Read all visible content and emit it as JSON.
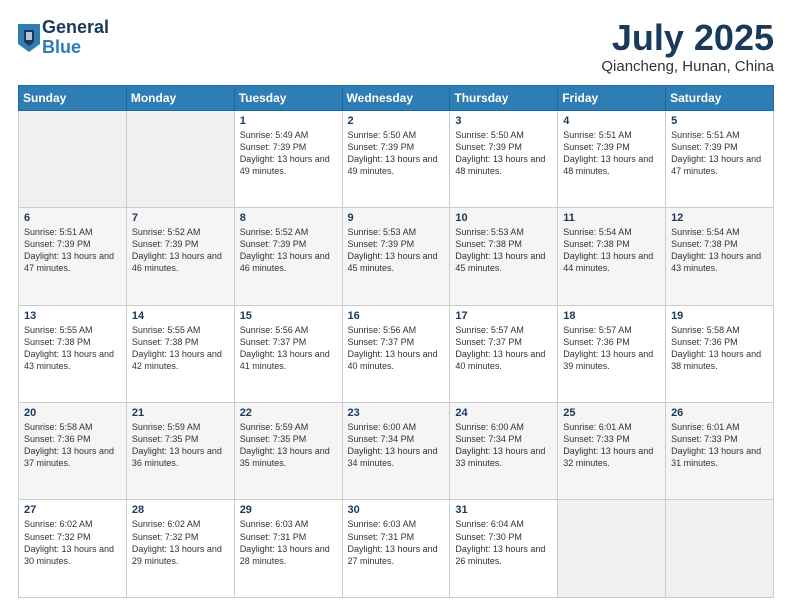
{
  "header": {
    "logo_general": "General",
    "logo_blue": "Blue",
    "month_title": "July 2025",
    "location": "Qiancheng, Hunan, China"
  },
  "weekdays": [
    "Sunday",
    "Monday",
    "Tuesday",
    "Wednesday",
    "Thursday",
    "Friday",
    "Saturday"
  ],
  "weeks": [
    [
      {
        "day": "",
        "info": ""
      },
      {
        "day": "",
        "info": ""
      },
      {
        "day": "1",
        "info": "Sunrise: 5:49 AM\nSunset: 7:39 PM\nDaylight: 13 hours and 49 minutes."
      },
      {
        "day": "2",
        "info": "Sunrise: 5:50 AM\nSunset: 7:39 PM\nDaylight: 13 hours and 49 minutes."
      },
      {
        "day": "3",
        "info": "Sunrise: 5:50 AM\nSunset: 7:39 PM\nDaylight: 13 hours and 48 minutes."
      },
      {
        "day": "4",
        "info": "Sunrise: 5:51 AM\nSunset: 7:39 PM\nDaylight: 13 hours and 48 minutes."
      },
      {
        "day": "5",
        "info": "Sunrise: 5:51 AM\nSunset: 7:39 PM\nDaylight: 13 hours and 47 minutes."
      }
    ],
    [
      {
        "day": "6",
        "info": "Sunrise: 5:51 AM\nSunset: 7:39 PM\nDaylight: 13 hours and 47 minutes."
      },
      {
        "day": "7",
        "info": "Sunrise: 5:52 AM\nSunset: 7:39 PM\nDaylight: 13 hours and 46 minutes."
      },
      {
        "day": "8",
        "info": "Sunrise: 5:52 AM\nSunset: 7:39 PM\nDaylight: 13 hours and 46 minutes."
      },
      {
        "day": "9",
        "info": "Sunrise: 5:53 AM\nSunset: 7:39 PM\nDaylight: 13 hours and 45 minutes."
      },
      {
        "day": "10",
        "info": "Sunrise: 5:53 AM\nSunset: 7:38 PM\nDaylight: 13 hours and 45 minutes."
      },
      {
        "day": "11",
        "info": "Sunrise: 5:54 AM\nSunset: 7:38 PM\nDaylight: 13 hours and 44 minutes."
      },
      {
        "day": "12",
        "info": "Sunrise: 5:54 AM\nSunset: 7:38 PM\nDaylight: 13 hours and 43 minutes."
      }
    ],
    [
      {
        "day": "13",
        "info": "Sunrise: 5:55 AM\nSunset: 7:38 PM\nDaylight: 13 hours and 43 minutes."
      },
      {
        "day": "14",
        "info": "Sunrise: 5:55 AM\nSunset: 7:38 PM\nDaylight: 13 hours and 42 minutes."
      },
      {
        "day": "15",
        "info": "Sunrise: 5:56 AM\nSunset: 7:37 PM\nDaylight: 13 hours and 41 minutes."
      },
      {
        "day": "16",
        "info": "Sunrise: 5:56 AM\nSunset: 7:37 PM\nDaylight: 13 hours and 40 minutes."
      },
      {
        "day": "17",
        "info": "Sunrise: 5:57 AM\nSunset: 7:37 PM\nDaylight: 13 hours and 40 minutes."
      },
      {
        "day": "18",
        "info": "Sunrise: 5:57 AM\nSunset: 7:36 PM\nDaylight: 13 hours and 39 minutes."
      },
      {
        "day": "19",
        "info": "Sunrise: 5:58 AM\nSunset: 7:36 PM\nDaylight: 13 hours and 38 minutes."
      }
    ],
    [
      {
        "day": "20",
        "info": "Sunrise: 5:58 AM\nSunset: 7:36 PM\nDaylight: 13 hours and 37 minutes."
      },
      {
        "day": "21",
        "info": "Sunrise: 5:59 AM\nSunset: 7:35 PM\nDaylight: 13 hours and 36 minutes."
      },
      {
        "day": "22",
        "info": "Sunrise: 5:59 AM\nSunset: 7:35 PM\nDaylight: 13 hours and 35 minutes."
      },
      {
        "day": "23",
        "info": "Sunrise: 6:00 AM\nSunset: 7:34 PM\nDaylight: 13 hours and 34 minutes."
      },
      {
        "day": "24",
        "info": "Sunrise: 6:00 AM\nSunset: 7:34 PM\nDaylight: 13 hours and 33 minutes."
      },
      {
        "day": "25",
        "info": "Sunrise: 6:01 AM\nSunset: 7:33 PM\nDaylight: 13 hours and 32 minutes."
      },
      {
        "day": "26",
        "info": "Sunrise: 6:01 AM\nSunset: 7:33 PM\nDaylight: 13 hours and 31 minutes."
      }
    ],
    [
      {
        "day": "27",
        "info": "Sunrise: 6:02 AM\nSunset: 7:32 PM\nDaylight: 13 hours and 30 minutes."
      },
      {
        "day": "28",
        "info": "Sunrise: 6:02 AM\nSunset: 7:32 PM\nDaylight: 13 hours and 29 minutes."
      },
      {
        "day": "29",
        "info": "Sunrise: 6:03 AM\nSunset: 7:31 PM\nDaylight: 13 hours and 28 minutes."
      },
      {
        "day": "30",
        "info": "Sunrise: 6:03 AM\nSunset: 7:31 PM\nDaylight: 13 hours and 27 minutes."
      },
      {
        "day": "31",
        "info": "Sunrise: 6:04 AM\nSunset: 7:30 PM\nDaylight: 13 hours and 26 minutes."
      },
      {
        "day": "",
        "info": ""
      },
      {
        "day": "",
        "info": ""
      }
    ]
  ]
}
